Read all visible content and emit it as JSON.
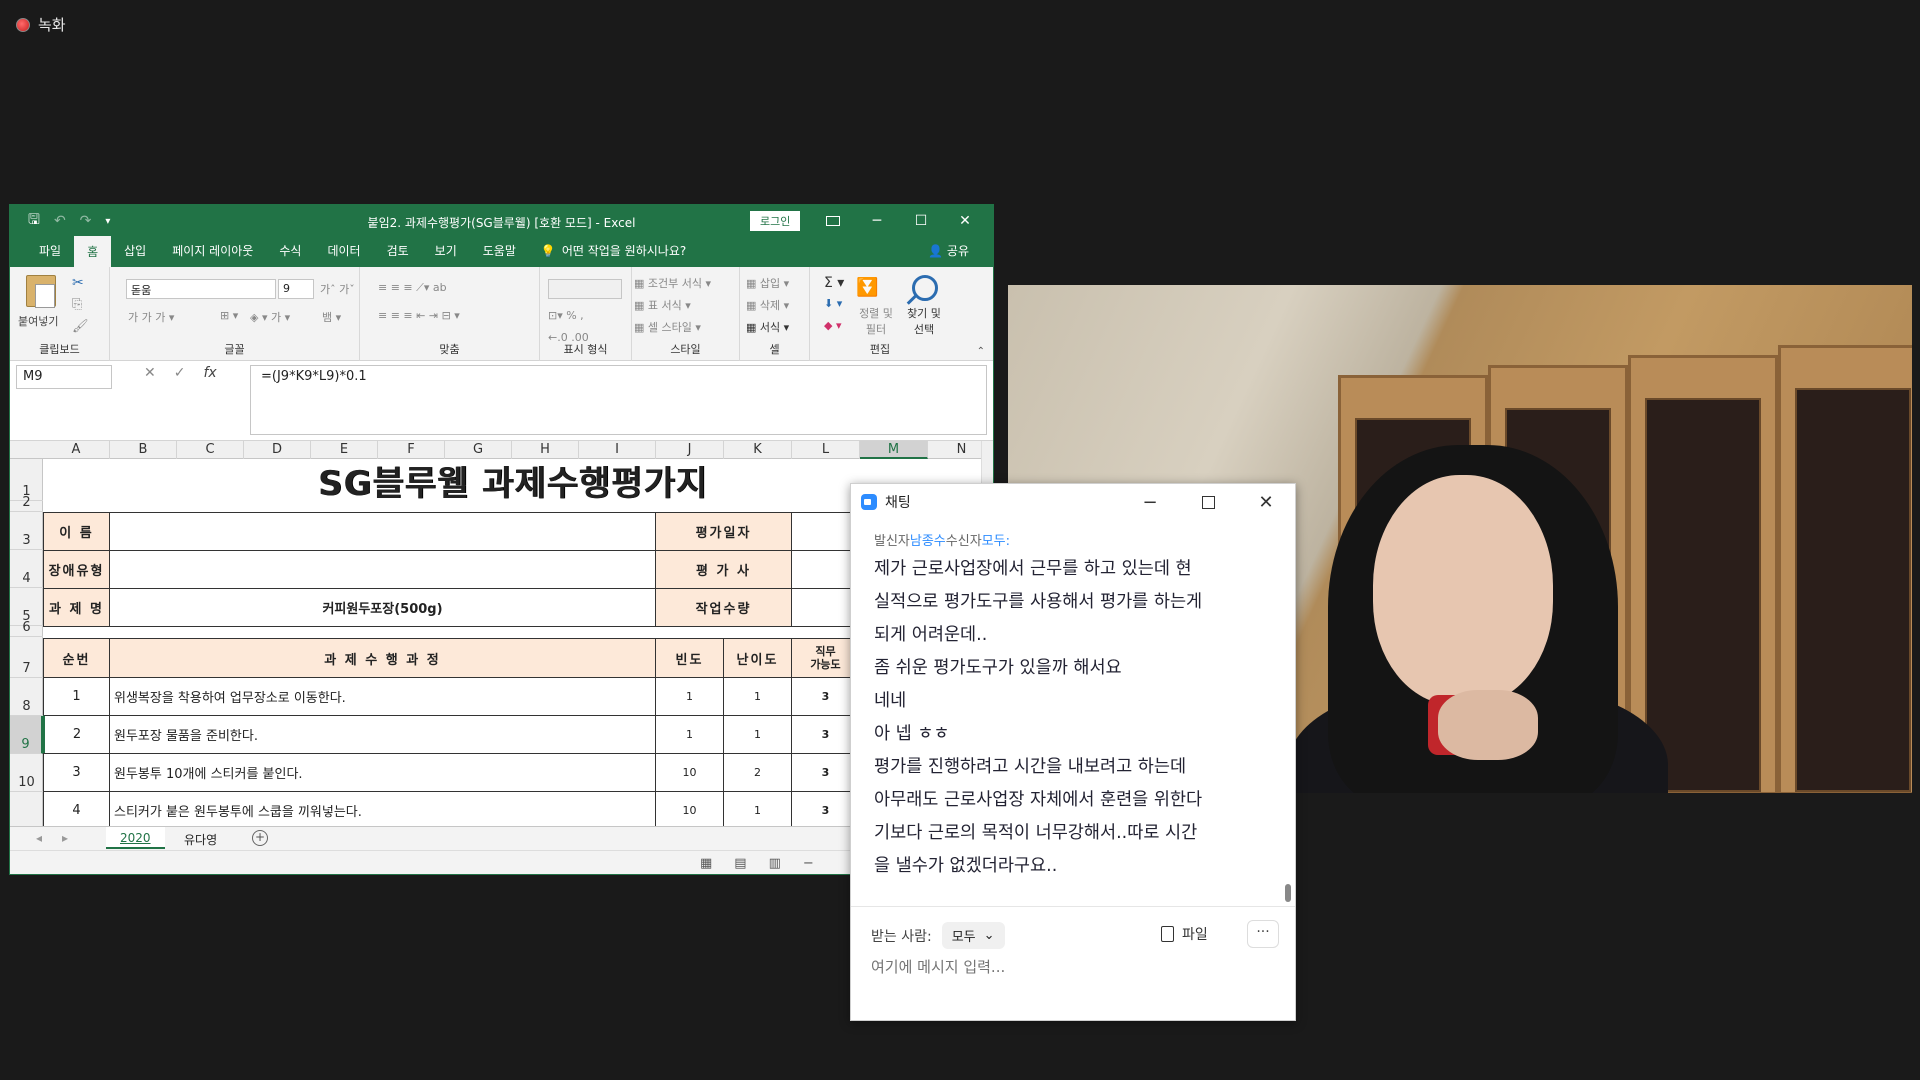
{
  "recording": {
    "label": "녹화"
  },
  "excel": {
    "title": "붙임2. 과제수행평가(SG블루웰)  [호환 모드]  -  Excel",
    "login": "로그인",
    "tabs": [
      "파일",
      "홈",
      "삽입",
      "페이지 레이아웃",
      "수식",
      "데이터",
      "검토",
      "보기",
      "도움말"
    ],
    "active_tab": "홈",
    "tell_me": "어떤 작업을 원하시나요?",
    "share": "공유",
    "ribbon": {
      "paste": "붙여넣기",
      "font_name": "돋움",
      "font_size": "9",
      "groups": [
        "클립보드",
        "글꼴",
        "맞춤",
        "표시 형식",
        "스타일",
        "셀",
        "편집"
      ],
      "conditional_format": "조건부 서식",
      "table_format": "표 서식",
      "cell_style": "셀 스타일",
      "insert": "삽입",
      "delete": "삭제",
      "format": "서식",
      "sort_filter": "정렬 및 필터",
      "find_select": "찾기 및 선택"
    },
    "name_box": "M9",
    "formula": "=(J9*K9*L9)*0.1",
    "columns": [
      "A",
      "B",
      "C",
      "D",
      "E",
      "F",
      "G",
      "H",
      "I",
      "J",
      "K",
      "L",
      "M",
      "N"
    ],
    "selected_column": "M",
    "rows": [
      "1",
      "2",
      "3",
      "4",
      "5",
      "6",
      "7",
      "8",
      "9",
      "10"
    ],
    "selected_row": "9",
    "sheet": {
      "title": "SG블루웰 과제수행평가지",
      "name_label": "이    름",
      "disability_label": "장애유형",
      "task_label": "과 제 명",
      "task_value": "커피원두포장(500g)",
      "eval_date_label": "평가일자",
      "evaluator_label": "평 가 사",
      "work_qty_label": "작업수량",
      "table_headers": {
        "no": "순번",
        "process": "과 제 수 행 과 정",
        "freq": "빈도",
        "difficulty": "난이도",
        "job_ability": "직무\n가능도"
      },
      "table_rows": [
        {
          "no": "1",
          "process": "위생복장을 착용하여 업무장소로 이동한다.",
          "freq": "1",
          "difficulty": "1",
          "ability": "3"
        },
        {
          "no": "2",
          "process": "원두포장 물품을 준비한다.",
          "freq": "1",
          "difficulty": "1",
          "ability": "3"
        },
        {
          "no": "3",
          "process": "원두봉투 10개에 스티커를 붙인다.",
          "freq": "10",
          "difficulty": "2",
          "ability": "3"
        },
        {
          "no": "4",
          "process": "스티커가 붙은 원두봉투에 스쿱을 끼워넣는다.",
          "freq": "10",
          "difficulty": "1",
          "ability": "3"
        }
      ]
    },
    "sheet_tabs": [
      "2020",
      "유다영"
    ],
    "active_sheet": "2020"
  },
  "chat": {
    "title": "채팅",
    "sender_prefix": "발신자",
    "sender": "남종수",
    "receiver_prefix": "수신자",
    "receiver": "모두:",
    "messages": [
      "제가 근로사업장에서 근무를 하고 있는데 현",
      "실적으로 평가도구를 사용해서 평가를 하는게",
      "되게 어려운데..",
      "좀 쉬운 평가도구가 있을까 해서요",
      "네네",
      "아 넵 ㅎㅎ",
      "평가를 진행하려고 시간을 내보려고 하는데",
      "아무래도 근로사업장 자체에서 훈련을 위한다",
      "기보다 근로의 목적이 너무강해서..따로 시간",
      "을 낼수가 없겠더라구요.."
    ],
    "to_label": "받는 사람:",
    "to_value": "모두",
    "file_label": "파일",
    "more": "···",
    "input_placeholder": "여기에 메시지 입력..."
  }
}
